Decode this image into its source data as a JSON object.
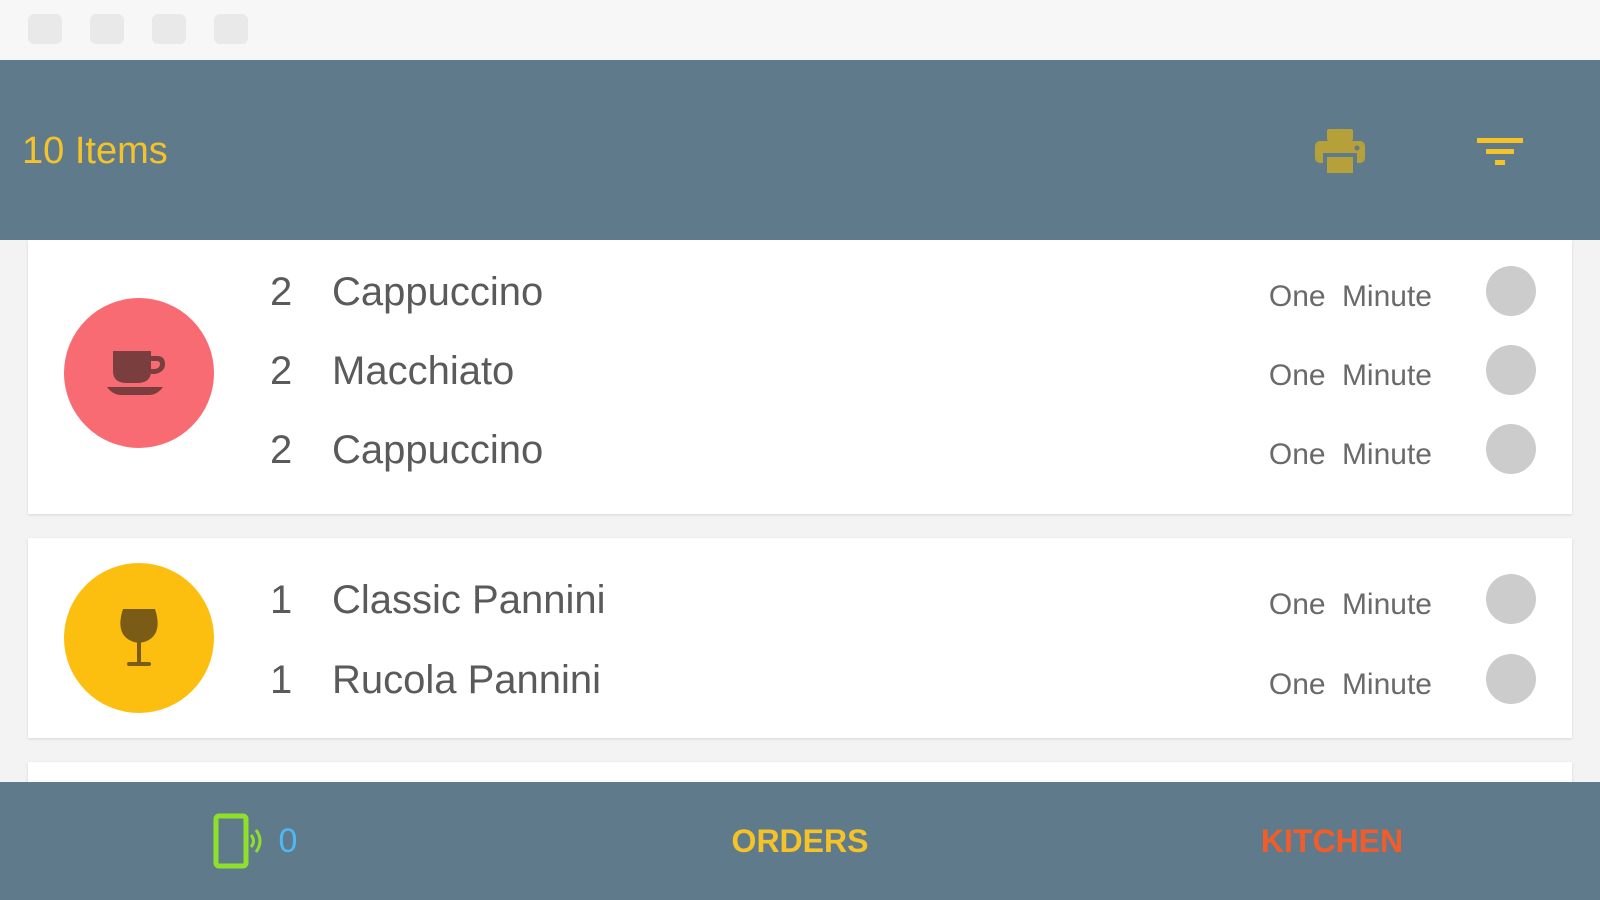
{
  "header": {
    "title": "10 Items",
    "print_icon": "printer-icon",
    "filter_icon": "filter-icon"
  },
  "colors": {
    "header_bg": "#5f7b8b",
    "accent_yellow": "#f5c228",
    "coffee_category": "#f96b72",
    "bar_category": "#fdbf0f",
    "kitchen_red": "#f25c2b",
    "device_blue": "#4fb8f0",
    "device_green": "#8ee02b",
    "status_grey": "#cccccc"
  },
  "orders": [
    {
      "category_icon": "coffee-cup-icon",
      "items": [
        {
          "qty": "2",
          "name": "Cappuccino",
          "time": "One Minute"
        },
        {
          "qty": "2",
          "name": "Macchiato",
          "time": "One Minute"
        },
        {
          "qty": "2",
          "name": "Cappuccino",
          "time": "One Minute"
        }
      ]
    },
    {
      "category_icon": "wine-glass-icon",
      "items": [
        {
          "qty": "1",
          "name": "Classic Pannini",
          "time": "One Minute"
        },
        {
          "qty": "1",
          "name": "Rucola Pannini",
          "time": "One Minute"
        }
      ]
    }
  ],
  "bottom_nav": {
    "device_icon": "phone-signal-icon",
    "device_count": "0",
    "orders_label": "ORDERS",
    "kitchen_label": "KITCHEN"
  }
}
